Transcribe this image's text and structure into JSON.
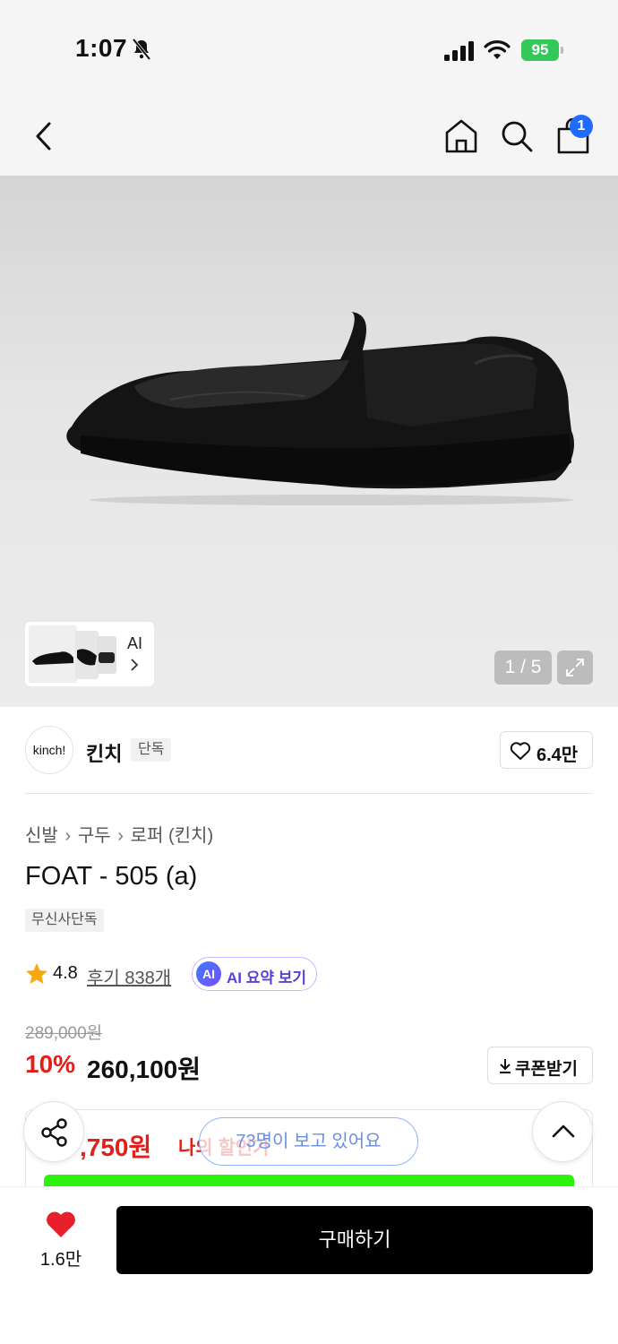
{
  "status_bar": {
    "time": "1:07",
    "battery": "95"
  },
  "nav": {
    "cart_count": "1"
  },
  "gallery": {
    "thumb_label": "AI",
    "pager": "1 / 5"
  },
  "brand": {
    "logo_text": "kinch!",
    "name": "킨치",
    "tag": "단독",
    "likes": "6.4만"
  },
  "product": {
    "breadcrumbs": [
      "신발",
      "구두",
      "로퍼 (킨치)"
    ],
    "title": "FOAT - 505 (a)",
    "exclusive_badge": "무신사단독",
    "rating": "4.8",
    "reviews": "후기 838개",
    "ai_summary_badge": "AI",
    "ai_summary": "AI 요약 보기",
    "original_price": "289,000원",
    "discount": "10%",
    "price": "260,100원",
    "coupon_button": "쿠폰받기",
    "my_price": ",750원",
    "my_discount_label": "나의 할인가",
    "viewers": "73명이 보고 있어요"
  },
  "bottom_bar": {
    "wish_count": "1.6만",
    "buy_button": "구매하기"
  },
  "colors": {
    "accent_red": "#e0211b",
    "badge_blue": "#1f6bff",
    "buy_black": "#000000",
    "battery_green": "#34c759"
  },
  "icons": [
    "bell-slash-icon",
    "signal-icon",
    "wifi-icon",
    "battery-icon",
    "back-chevron-icon",
    "home-icon",
    "search-icon",
    "bag-icon",
    "expand-icon",
    "heart-outline-icon",
    "star-icon",
    "download-icon",
    "share-icon",
    "chevron-up-icon",
    "heart-filled-icon"
  ]
}
